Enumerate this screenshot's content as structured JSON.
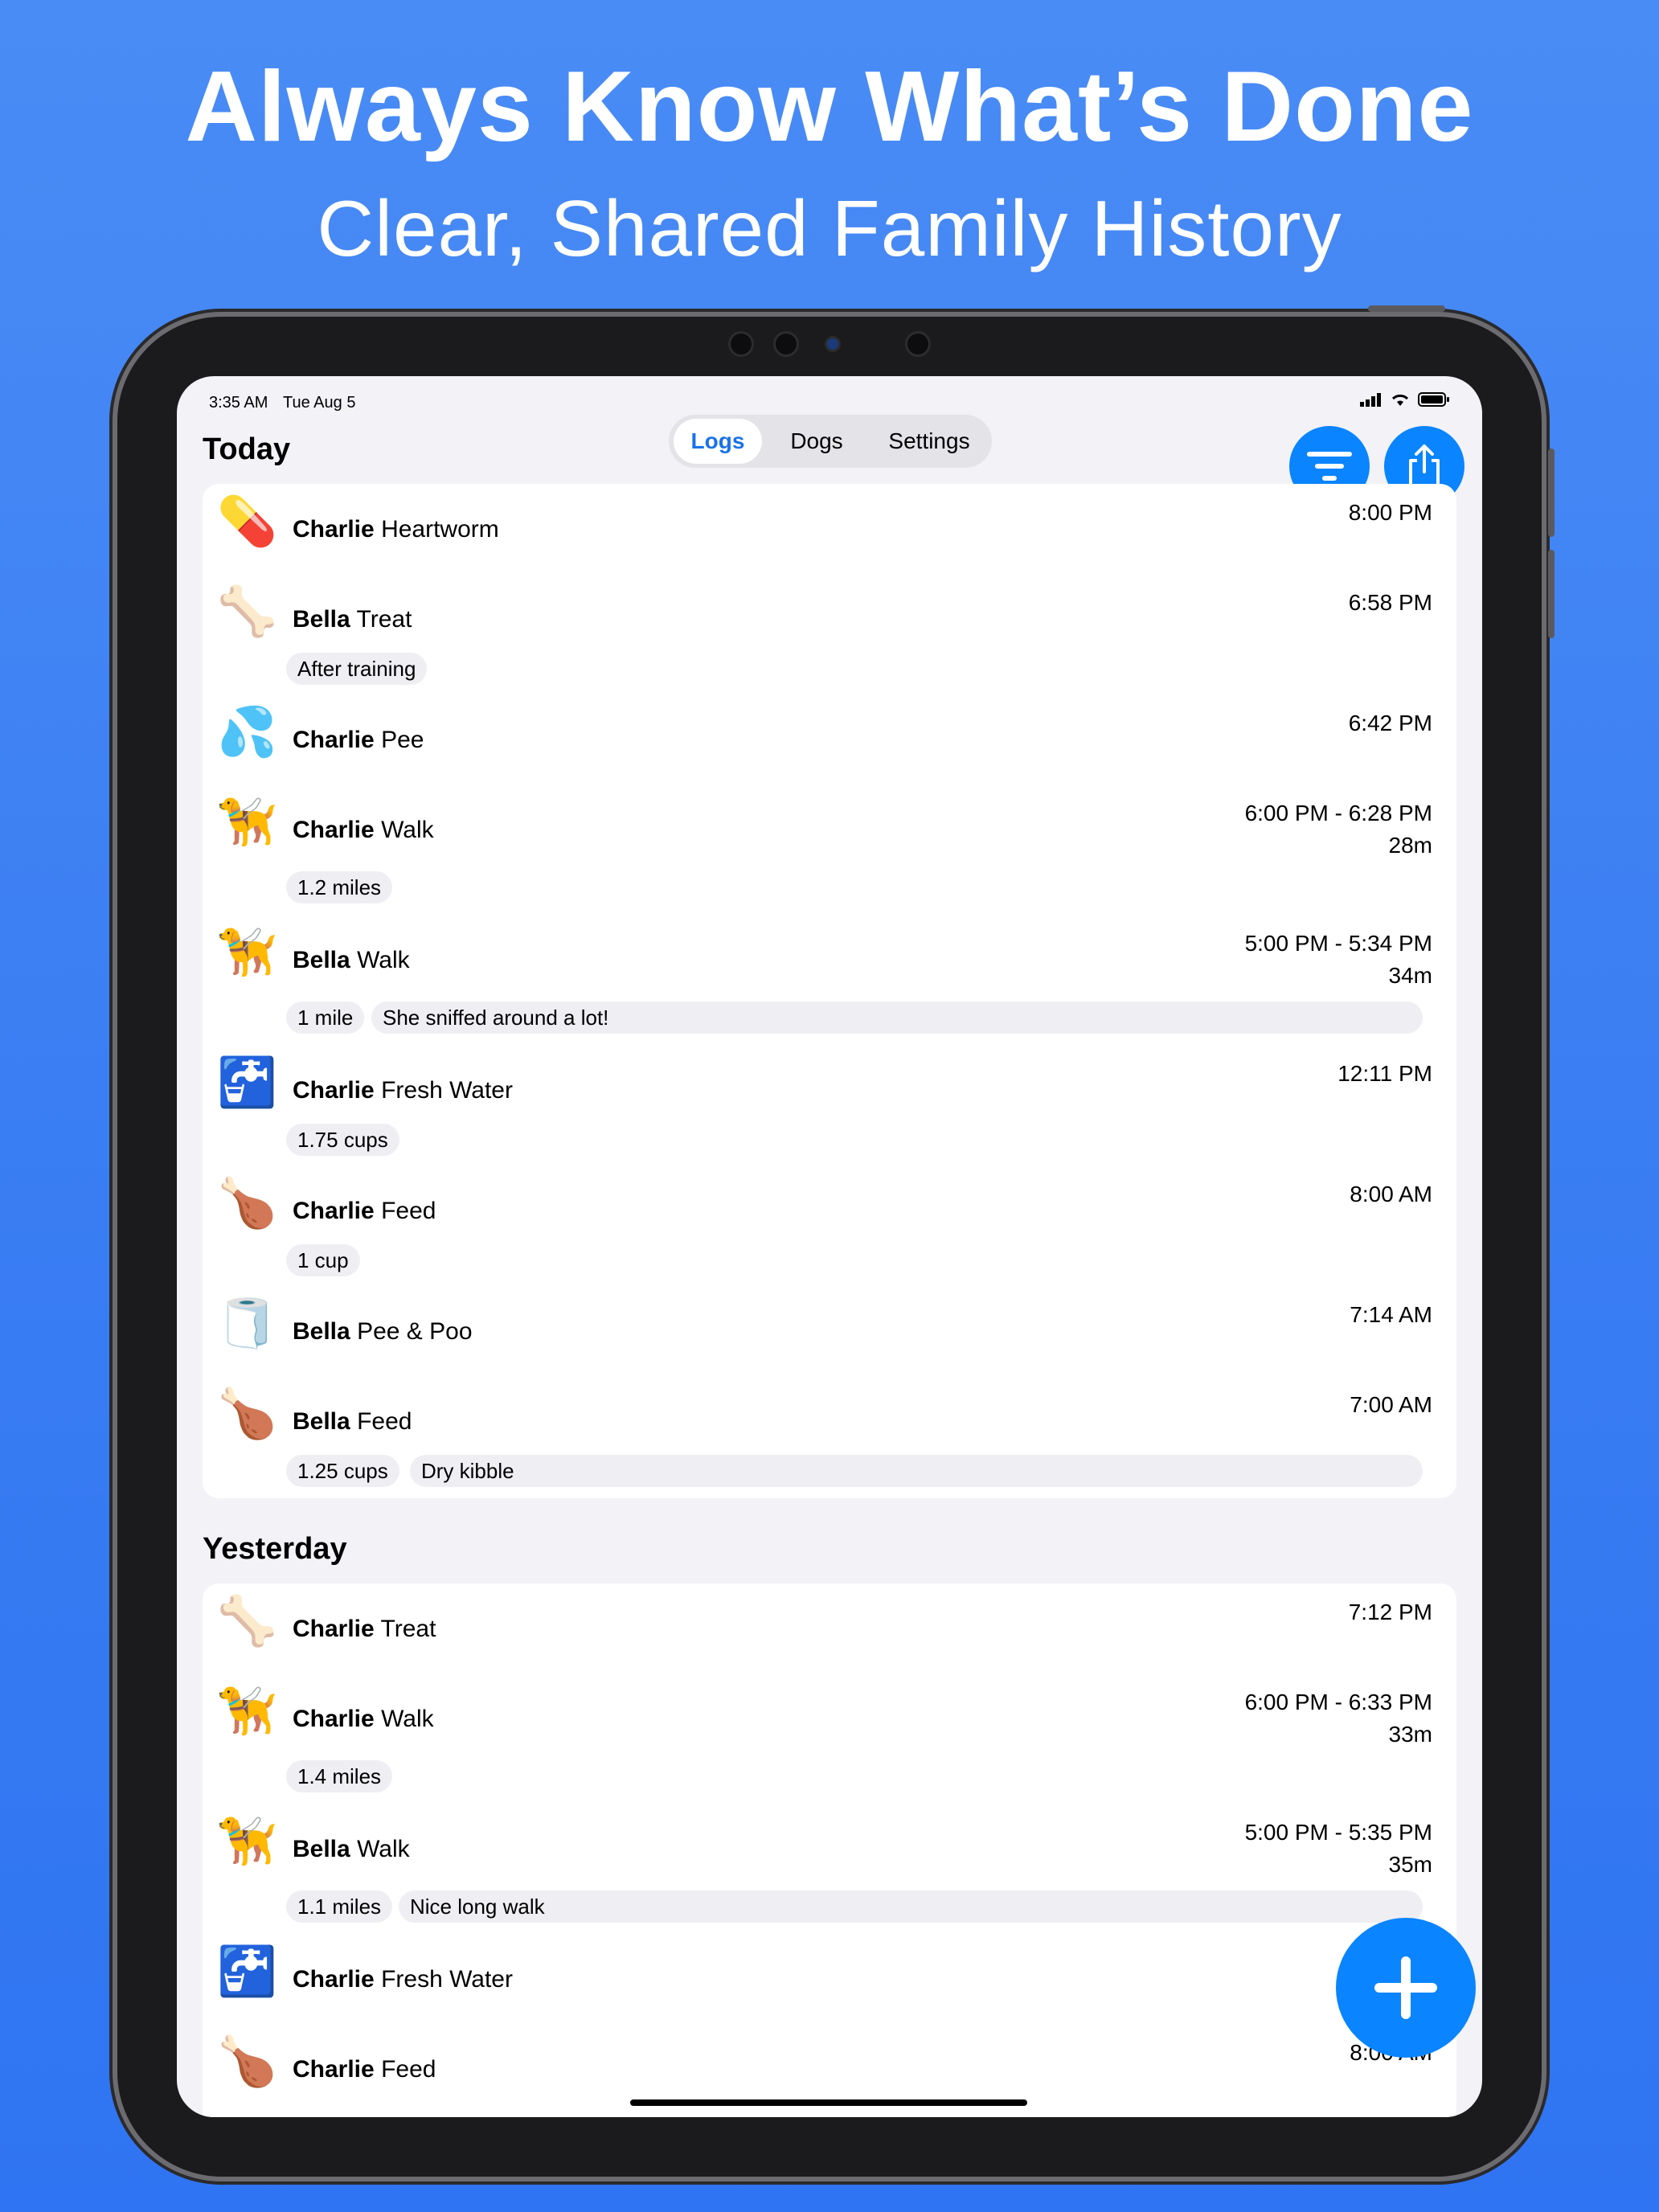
{
  "headline": "Always Know What’s Done",
  "subheadline": "Clear, Shared Family History",
  "status_bar": {
    "time": "3:35 AM",
    "date": "Tue Aug 5"
  },
  "tabs": [
    {
      "label": "Logs",
      "active": true
    },
    {
      "label": "Dogs",
      "active": false
    },
    {
      "label": "Settings",
      "active": false
    }
  ],
  "toolbar": {
    "filter_icon": "filter-icon",
    "share_icon": "share-icon",
    "add_icon": "plus-icon"
  },
  "sections": [
    {
      "title": "Today",
      "entries": [
        {
          "emoji": "💊",
          "dog": "Charlie",
          "action": "Heartworm",
          "time": "8:00 PM",
          "duration": "",
          "chips": []
        },
        {
          "emoji": "🦴",
          "dog": "Bella",
          "action": "Treat",
          "time": "6:58 PM",
          "duration": "",
          "chips": [
            "After training"
          ]
        },
        {
          "emoji": "💦",
          "dog": "Charlie",
          "action": "Pee",
          "time": "6:42 PM",
          "duration": "",
          "chips": []
        },
        {
          "emoji": "🦮",
          "dog": "Charlie",
          "action": "Walk",
          "time": "6:00 PM - 6:28 PM",
          "duration": "28m",
          "chips": [
            "1.2 miles"
          ]
        },
        {
          "emoji": "🦮",
          "dog": "Bella",
          "action": "Walk",
          "time": "5:00 PM - 5:34 PM",
          "duration": "34m",
          "chips": [
            "1 mile"
          ],
          "note": "She sniffed around a lot!"
        },
        {
          "emoji": "🚰",
          "dog": "Charlie",
          "action": "Fresh Water",
          "time": "12:11 PM",
          "duration": "",
          "chips": [
            "1.75 cups"
          ]
        },
        {
          "emoji": "🍗",
          "dog": "Charlie",
          "action": "Feed",
          "time": "8:00 AM",
          "duration": "",
          "chips": [
            "1 cup"
          ]
        },
        {
          "emoji": "🧻",
          "dog": "Bella",
          "action": "Pee & Poo",
          "time": "7:14 AM",
          "duration": "",
          "chips": []
        },
        {
          "emoji": "🍗",
          "dog": "Bella",
          "action": "Feed",
          "time": "7:00 AM",
          "duration": "",
          "chips": [
            "1.25 cups"
          ],
          "note": "Dry kibble"
        }
      ]
    },
    {
      "title": "Yesterday",
      "entries": [
        {
          "emoji": "🦴",
          "dog": "Charlie",
          "action": "Treat",
          "time": "7:12 PM",
          "duration": "",
          "chips": []
        },
        {
          "emoji": "🦮",
          "dog": "Charlie",
          "action": "Walk",
          "time": "6:00 PM - 6:33 PM",
          "duration": "33m",
          "chips": [
            "1.4 miles"
          ]
        },
        {
          "emoji": "🦮",
          "dog": "Bella",
          "action": "Walk",
          "time": "5:00 PM - 5:35 PM",
          "duration": "35m",
          "chips": [
            "1.1 miles"
          ],
          "note": "Nice long walk"
        },
        {
          "emoji": "🚰",
          "dog": "Charlie",
          "action": "Fresh Water",
          "time": "",
          "duration": "",
          "chips": []
        },
        {
          "emoji": "🍗",
          "dog": "Charlie",
          "action": "Feed",
          "time": "8:00 AM",
          "duration": "",
          "chips": []
        }
      ]
    }
  ]
}
